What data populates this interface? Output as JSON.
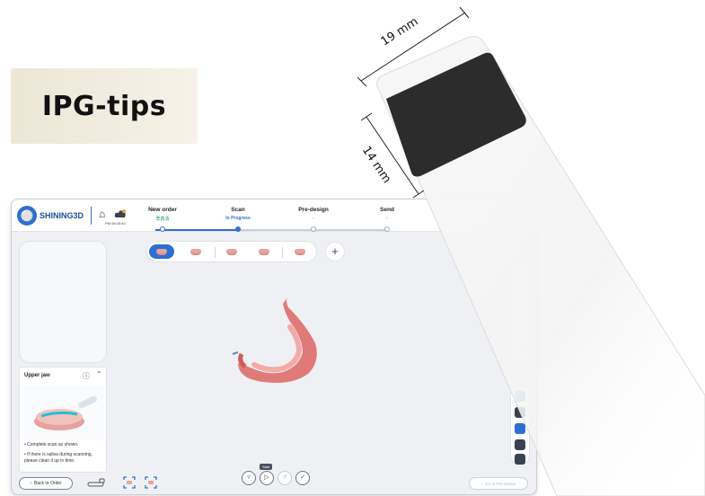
{
  "banner": {
    "title": "IPG-tips"
  },
  "dimensions": {
    "width_label": "19 mm",
    "height_label": "14 mm"
  },
  "app": {
    "brand": "SHINING3D",
    "time": "PM 06:28:40",
    "steps": [
      {
        "label": "New order",
        "sub": "李真清"
      },
      {
        "label": "Scan",
        "sub": "In Progress"
      },
      {
        "label": "Pre-design",
        "sub": "-"
      },
      {
        "label": "Send",
        "sub": "-"
      }
    ],
    "left_panel": {
      "title": "Upper jaw",
      "hints": [
        "Complete scan as shown.",
        "If there is saliva during scanning, please clean it up in time."
      ]
    },
    "bottom": {
      "back_label": "Back to Order",
      "start_badge": "Start",
      "next_label": "Go to Pre-design"
    },
    "colors": {
      "accent": "#2f6fd1",
      "gum": "#e07a78",
      "status_green": "#1a9a64"
    }
  }
}
